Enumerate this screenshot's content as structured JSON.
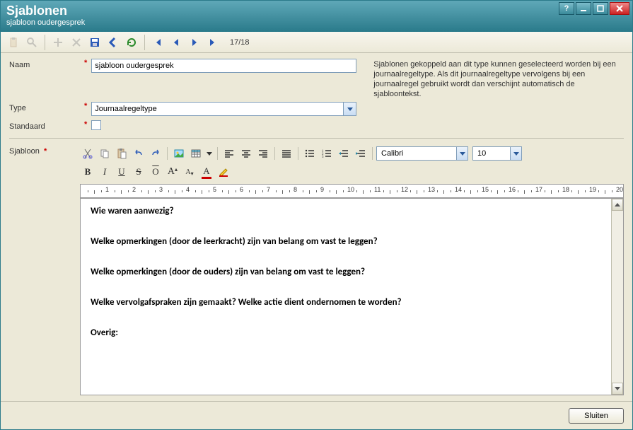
{
  "window": {
    "title": "Sjablonen",
    "subtitle": "sjabloon oudergesprek"
  },
  "toolbar": {
    "page_indicator": "17/18"
  },
  "form": {
    "labels": {
      "name": "Naam",
      "type": "Type",
      "default": "Standaard",
      "template": "Sjabloon"
    },
    "name_value": "sjabloon oudergesprek",
    "type_value": "Journaalregeltype",
    "default_checked": false,
    "info_text": "Sjablonen gekoppeld aan dit type kunnen geselecteerd worden bij een journaalregeltype. Als dit journaalregeltype vervolgens bij een journaalregel gebruikt wordt dan verschijnt automatisch de sjabloontekst."
  },
  "editor": {
    "font_name": "Calibri",
    "font_size": "10",
    "ruler_max": 20,
    "content": {
      "p1": "Wie waren aanwezig?",
      "p2": "Welke opmerkingen (door de leerkracht) zijn van belang om vast te leggen?",
      "p3": "Welke opmerkingen (door de ouders) zijn van belang om vast te leggen?",
      "p4": "Welke vervolgafspraken zijn gemaakt? Welke actie dient ondernomen te worden?",
      "p5": "Overig:"
    }
  },
  "footer": {
    "close_label": "Sluiten"
  }
}
